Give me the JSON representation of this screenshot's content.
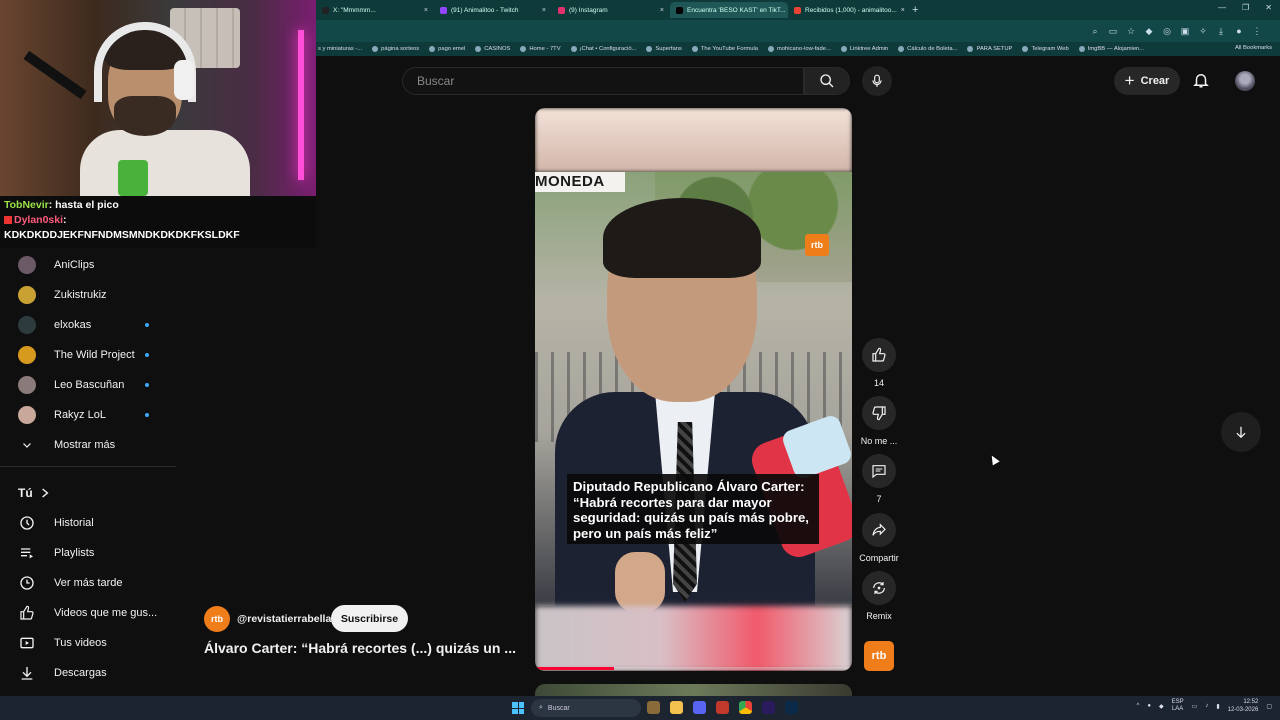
{
  "browser": {
    "tabs": [
      {
        "label": "X: \"Mmmmm...",
        "color": "#222222"
      },
      {
        "label": "(91) Animalitoo - Twitch",
        "color": "#9146ff"
      },
      {
        "label": "(9) Instagram",
        "color": "#e1306c"
      },
      {
        "label": "Encuentra 'BESO KAST' en TikT...",
        "color": "#000000"
      },
      {
        "label": "Recibidos (1,000) - animalitoo...",
        "color": "#ea4335"
      }
    ],
    "bookmarks": [
      "s y miniaturas -...",
      "página sorteos",
      "pago emel",
      "CASINOS",
      "Home - 7TV",
      "¡Chat • Configuració...",
      "Superfans",
      "The YouTube Formula",
      "mohicano-low-fade...",
      "Linktree Admin",
      "Cálculo de Boleta...",
      "PARA SETUP",
      "Telegram Web",
      "ImgBB — Alojamien..."
    ],
    "all_bookmarks": "All Bookmarks"
  },
  "header": {
    "search_placeholder": "Buscar",
    "create_label": "Crear"
  },
  "chat": [
    {
      "user": "TobNevir",
      "text": ": hasta el pico"
    },
    {
      "user": "Dylan0ski",
      "text": ":"
    },
    {
      "user": "",
      "text": "KDKDKDDJEKFNFNDMSMNDKDKDKFKSLDKF"
    }
  ],
  "sidebar": {
    "subscriptions": [
      {
        "label": "AniClips",
        "color": "#6b5a66",
        "new": false
      },
      {
        "label": "Zukistrukiz",
        "color": "#c9a032",
        "new": false
      },
      {
        "label": "elxokas",
        "color": "#2d3a3e",
        "new": true
      },
      {
        "label": "The Wild Project",
        "color": "#d69a1e",
        "new": true
      },
      {
        "label": "Leo Bascuñan",
        "color": "#8a7a7a",
        "new": true
      },
      {
        "label": "Rakyz LoL",
        "color": "#c8a89a",
        "new": true
      }
    ],
    "show_more": "Mostrar más",
    "you_section": "Tú",
    "you_items": [
      {
        "label": "Historial",
        "icon": "history-icon"
      },
      {
        "label": "Playlists",
        "icon": "playlists-icon"
      },
      {
        "label": "Ver más tarde",
        "icon": "watch-later-icon"
      },
      {
        "label": "Videos que me gus...",
        "icon": "liked-videos-icon"
      },
      {
        "label": "Tus videos",
        "icon": "your-videos-icon"
      },
      {
        "label": "Descargas",
        "icon": "downloads-icon"
      }
    ]
  },
  "short": {
    "location_text": "MONEDA",
    "watermark": "rtb",
    "caption": "Diputado Republicano Álvaro Carter: “Habrá recortes para dar mayor seguridad: quizás un país más pobre, pero un país más feliz”",
    "progress": 0.25,
    "channel_avatar": "rtb",
    "channel_handle": "@revistatierrabella",
    "subscribe_label": "Suscribirse",
    "title": "Álvaro Carter: “Habrá recortes (...) quizás un ..."
  },
  "actions": {
    "like_count": "14",
    "dislike_label": "No me ...",
    "comments_count": "7",
    "share_label": "Compartir",
    "remix_label": "Remix"
  },
  "taskbar": {
    "search_label": "Buscar",
    "lang": "ESP",
    "lang_sub": "LAA",
    "time": "12:52",
    "date": "12-03-2026"
  }
}
